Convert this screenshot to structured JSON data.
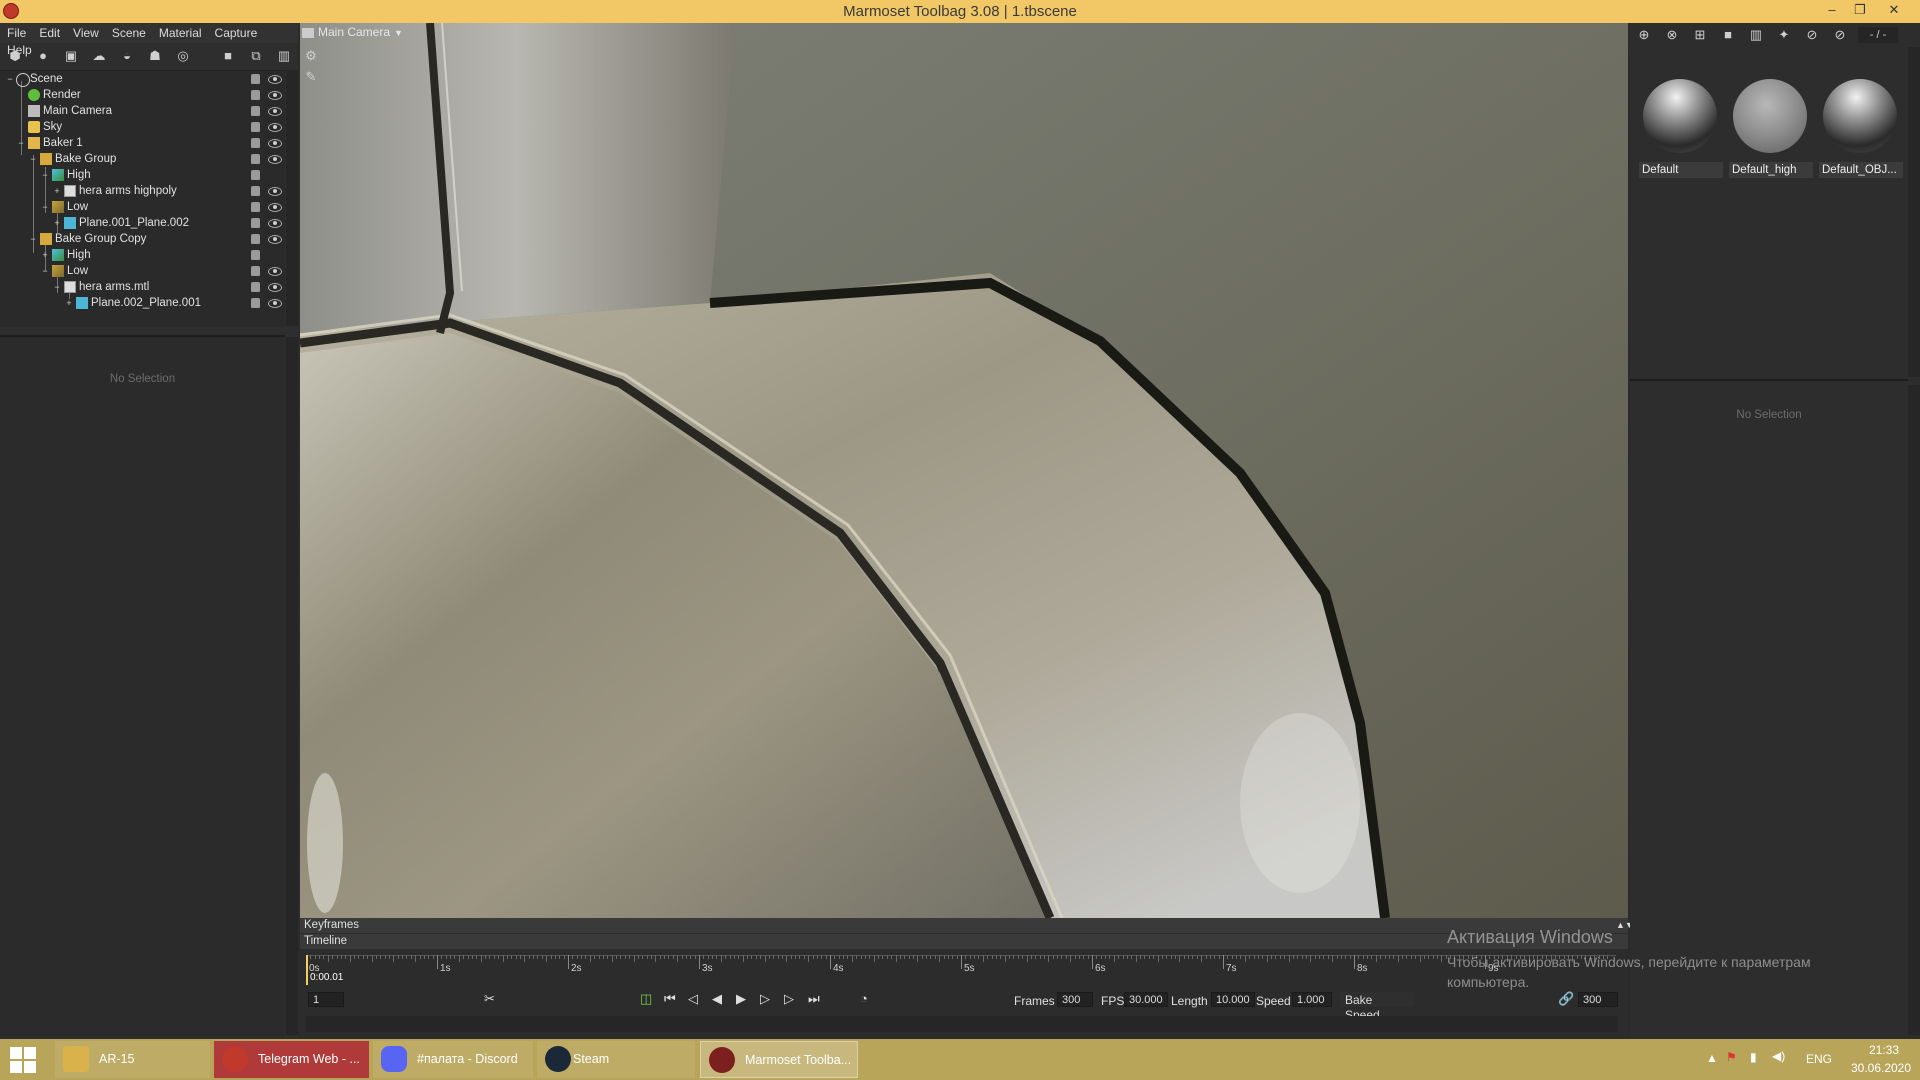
{
  "window": {
    "title": "Marmoset Toolbag 3.08  |  1.tbscene",
    "buttons": {
      "minimize": "–",
      "restore": "❐",
      "close": "✕"
    }
  },
  "menu": [
    "File",
    "Edit",
    "View",
    "Scene",
    "Material",
    "Capture",
    "Help"
  ],
  "scene_toolbar_icons": [
    "add-object-icon",
    "light-icon",
    "camera-icon",
    "sky-icon",
    "shadow-catcher-icon",
    "baker-icon",
    "fog-icon",
    "folder-icon",
    "duplicate-icon",
    "delete-icon"
  ],
  "outliner": {
    "items": [
      {
        "label": "Scene",
        "icon": "scene-icon"
      },
      {
        "label": "Render",
        "icon": "render-icon"
      },
      {
        "label": "Main Camera",
        "icon": "camera-icon"
      },
      {
        "label": "Sky",
        "icon": "sky-icon"
      },
      {
        "label": "Baker 1",
        "icon": "baker-icon"
      },
      {
        "label": "Bake Group",
        "icon": "folder-icon"
      },
      {
        "label": "High",
        "icon": "high-group-icon"
      },
      {
        "label": "hera arms highpoly",
        "icon": "mesh-icon"
      },
      {
        "label": "Low",
        "icon": "low-group-icon"
      },
      {
        "label": "Plane.001_Plane.002",
        "icon": "mesh-icon"
      },
      {
        "label": "Bake Group Copy",
        "icon": "folder-icon"
      },
      {
        "label": "High",
        "icon": "high-group-icon"
      },
      {
        "label": "Low",
        "icon": "low-group-icon"
      },
      {
        "label": "hera arms.mtl",
        "icon": "mesh-icon"
      },
      {
        "label": "Plane.002_Plane.001",
        "icon": "mesh-icon"
      }
    ]
  },
  "properties_left": {
    "empty_text": "No Selection"
  },
  "viewport": {
    "camera_label": "Main Camera"
  },
  "timeline": {
    "keyframes_label": "Keyframes",
    "timeline_label": "Timeline",
    "tick_labels": [
      "0s",
      "1s",
      "2s",
      "3s",
      "4s",
      "5s",
      "6s",
      "7s",
      "8s",
      "9s"
    ],
    "current_time": "0:00.01",
    "current_frame": "1",
    "frames_label": "Frames",
    "frames_value": "300",
    "fps_label": "FPS",
    "fps_value": "30.000",
    "length_label": "Length",
    "length_value": "10.000",
    "speed_label": "Speed",
    "speed_value": "1.000",
    "bake_speed_label": "Bake Speed",
    "end_frame_value": "300"
  },
  "materials": {
    "items": [
      {
        "name": "Default"
      },
      {
        "name": "Default_high"
      },
      {
        "name": "Default_OBJ..."
      }
    ],
    "page_label": "- / -"
  },
  "properties_right": {
    "empty_text": "No Selection"
  },
  "activation": {
    "title": "Активация Windows",
    "message": "Чтобы активировать Windows, перейдите к параметрам компьютера."
  },
  "taskbar": {
    "apps": [
      {
        "label": "AR-15",
        "icon": "folder-icon",
        "color": "#d9b24c"
      },
      {
        "label": "Telegram Web - ...",
        "icon": "browser-icon",
        "color": "#c0392b"
      },
      {
        "label": "#палата - Discord",
        "icon": "discord-icon",
        "color": "#5865f2"
      },
      {
        "label": "Steam",
        "icon": "steam-icon",
        "color": "#1b2838"
      },
      {
        "label": "Marmoset Toolba...",
        "icon": "marmoset-icon",
        "color": "#7b1f1f"
      }
    ],
    "tray": {
      "lang": "ENG",
      "time": "21:33",
      "date": "30.06.2020"
    }
  },
  "colors": {
    "titlebar": "#f2c867",
    "taskbar": "#b9a55a",
    "panel": "#2e2e2e",
    "viewport_bg": "#6f706a"
  }
}
